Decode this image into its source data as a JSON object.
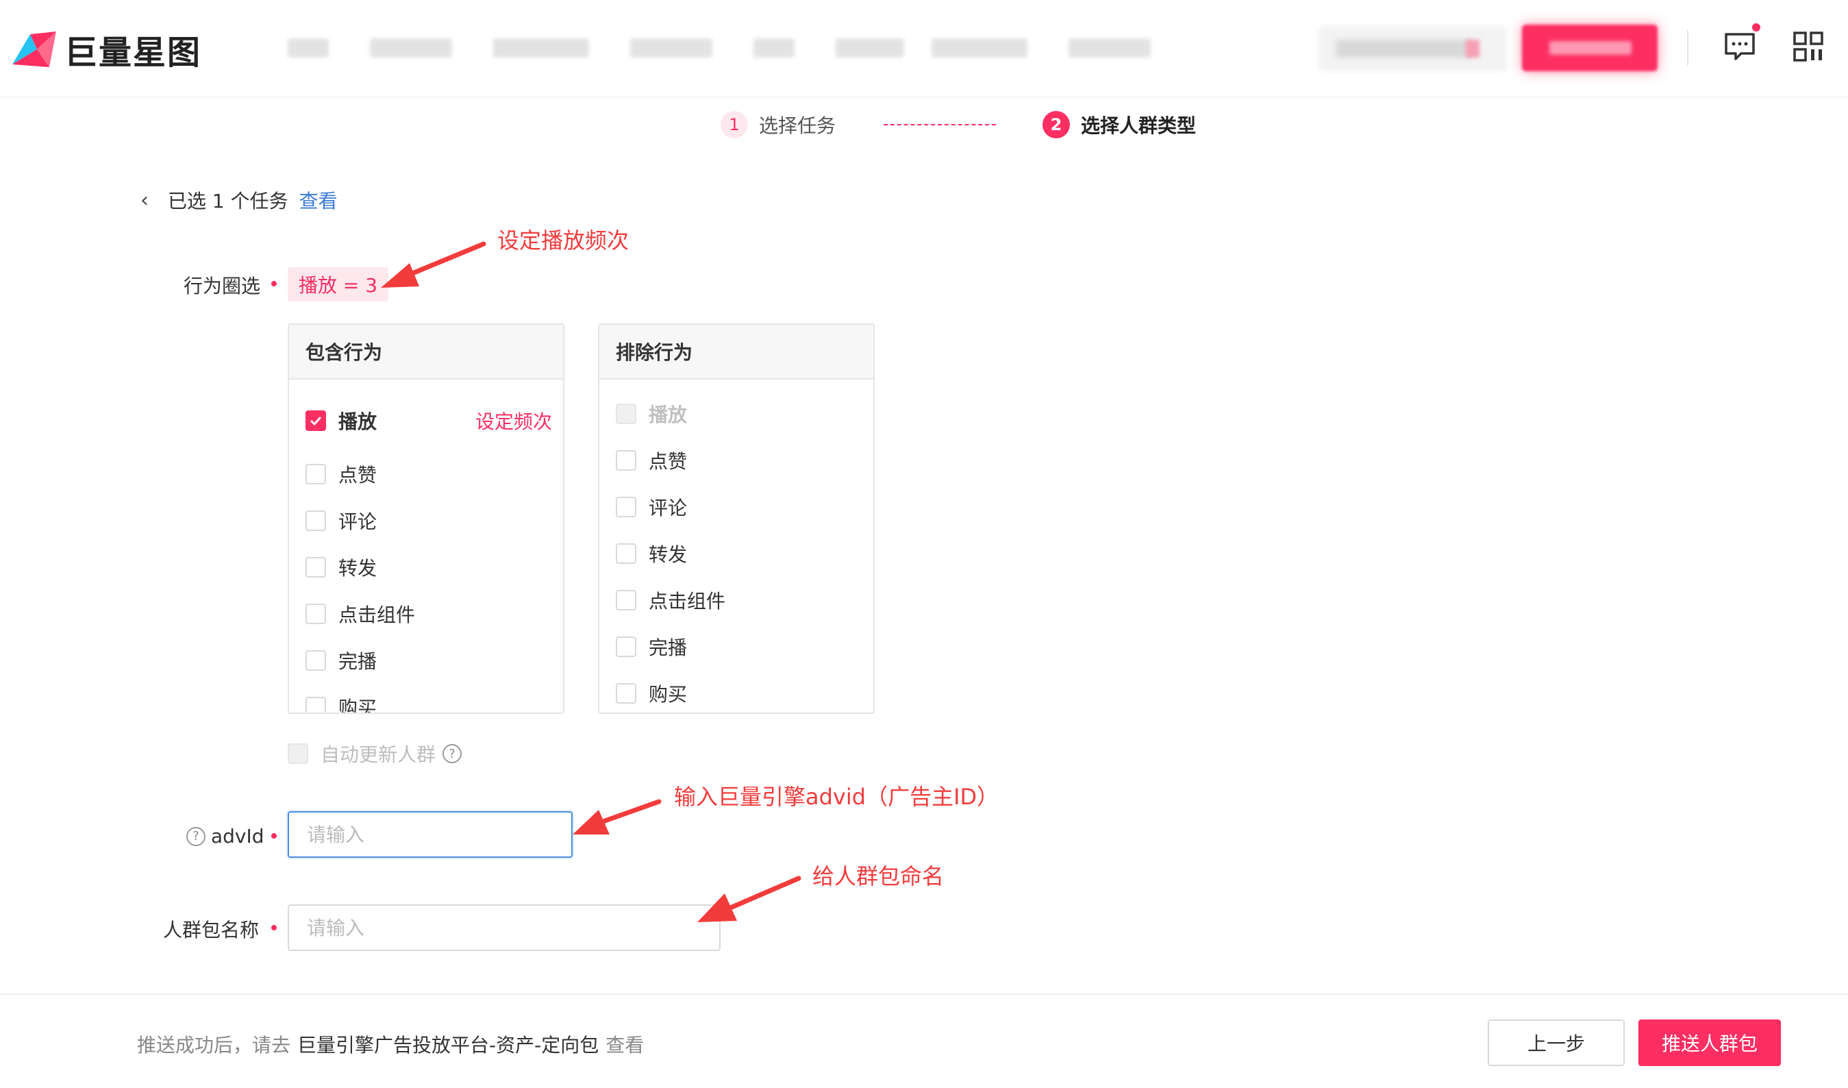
{
  "header": {
    "logo_text": "巨量星图",
    "colors": {
      "brand": "#fc2e62",
      "link": "#3a7bd5",
      "annotation": "#f23c3c"
    }
  },
  "steps": [
    {
      "num": "1",
      "label": "选择任务"
    },
    {
      "num": "2",
      "label": "选择人群类型"
    }
  ],
  "selected": {
    "text": "已选 1 个任务",
    "view_label": "查看"
  },
  "behavior": {
    "label": "行为圈选",
    "tag": "播放 = 3",
    "include": {
      "title": "包含行为",
      "freq_link": "设定频次",
      "options": [
        "播放",
        "点赞",
        "评论",
        "转发",
        "点击组件",
        "完播",
        "购买"
      ]
    },
    "exclude": {
      "title": "排除行为",
      "options": [
        "播放",
        "点赞",
        "评论",
        "转发",
        "点击组件",
        "完播",
        "购买"
      ]
    },
    "auto_update_label": "自动更新人群"
  },
  "advid": {
    "label": "advId",
    "placeholder": "请输入"
  },
  "crowd_name": {
    "label": "人群包名称",
    "placeholder": "请输入"
  },
  "annotations": {
    "freq": "设定播放频次",
    "advid": "输入巨量引擎advid（广告主ID）",
    "name": "给人群包命名"
  },
  "footer": {
    "tip_prefix": "推送成功后，请去",
    "tip_path": "巨量引擎广告投放平台-资产-定向包",
    "tip_view": "查看",
    "prev_label": "上一步",
    "push_label": "推送人群包"
  },
  "icons": [
    "message-icon",
    "qr-code-icon",
    "back-arrow-icon",
    "help-icon",
    "checkbox-check-icon"
  ]
}
